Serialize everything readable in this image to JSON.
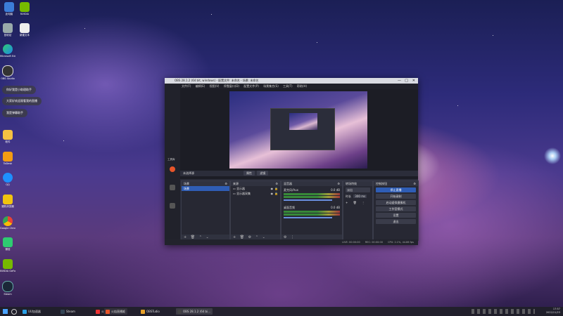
{
  "desktop": {
    "icons": [
      {
        "label": "此电脑"
      },
      {
        "label": "回收站"
      },
      {
        "label": "Microsoft Edge"
      },
      {
        "label": "OBS Studio"
      },
      {
        "label": "软件"
      },
      {
        "label": "ToDesk"
      },
      {
        "label": "QQ"
      },
      {
        "label": "猎豹浏览器"
      },
      {
        "label": "Google Chrome"
      },
      {
        "label": "微信"
      },
      {
        "label": "NVIDIA GeForce"
      },
      {
        "label": "Steam"
      }
    ],
    "icons_top": [
      {
        "label": "此电脑"
      },
      {
        "label": "NVIDIA"
      },
      {
        "label": "新建文本"
      }
    ],
    "notifications": [
      {
        "text": "你好我是小助理助手"
      },
      {
        "text": "大家好欢迎观看我的直播"
      },
      {
        "text": "我是弹幕助手"
      }
    ]
  },
  "obs": {
    "title": "OBS 28.1.2 (64 bit, windows) - 配置文件: 未命名 - 场景: 未命名",
    "window_controls": [
      "—",
      "□",
      "✕"
    ],
    "menu": [
      "文件(F)",
      "编辑(E)",
      "视图(V)",
      "停靠窗口(D)",
      "配置文件(P)",
      "场景集合(S)",
      "工具(T)",
      "帮助(H)"
    ],
    "left_strip_labels": [
      "工具库"
    ],
    "status_left": "未选择源",
    "preview_tabs": [
      "属性",
      "滤镜"
    ],
    "docks": {
      "scenes": {
        "title": "场景",
        "items": [
          "场景"
        ]
      },
      "sources": {
        "title": "来源",
        "items": [
          "显示器",
          "显示器采集"
        ]
      },
      "mixer": {
        "title": "混音器",
        "channels": [
          {
            "name": "麦克风/Aux",
            "db": "0.0 dB"
          },
          {
            "name": "桌面音频",
            "db": "0.0 dB"
          }
        ]
      },
      "transitions": {
        "title": "转场特效",
        "type": "淡出",
        "duration_label": "时长",
        "duration": "300 ms"
      },
      "controls": {
        "title": "控制按钮",
        "buttons": [
          "停止直播",
          "开始录制",
          "启动虚拟摄像机",
          "工作室模式",
          "设置",
          "退出"
        ]
      }
    },
    "footer_icons": [
      "+",
      "🗑",
      "⌃",
      "⌄"
    ],
    "statusbar": {
      "live": "LIVE: 00:00:00",
      "rec": "REC: 00:00:00",
      "cpu": "CPU: 2.1%, 44.86 fps"
    }
  },
  "taskbar": {
    "items": [
      {
        "label": "UU加速器",
        "color": "#2aa0e6"
      },
      {
        "label": "Steam",
        "color": "#345"
      },
      {
        "label": "火",
        "color": "#e33"
      },
      {
        "label": "火焰直播姬",
        "color": "#e8552a"
      },
      {
        "label": "OBSTudio",
        "color": "#e7a12a"
      },
      {
        "label": "OBS 28.1.2 (64 bi...",
        "color": "#444"
      }
    ],
    "time": "17:57",
    "date": "2022/11/23"
  }
}
